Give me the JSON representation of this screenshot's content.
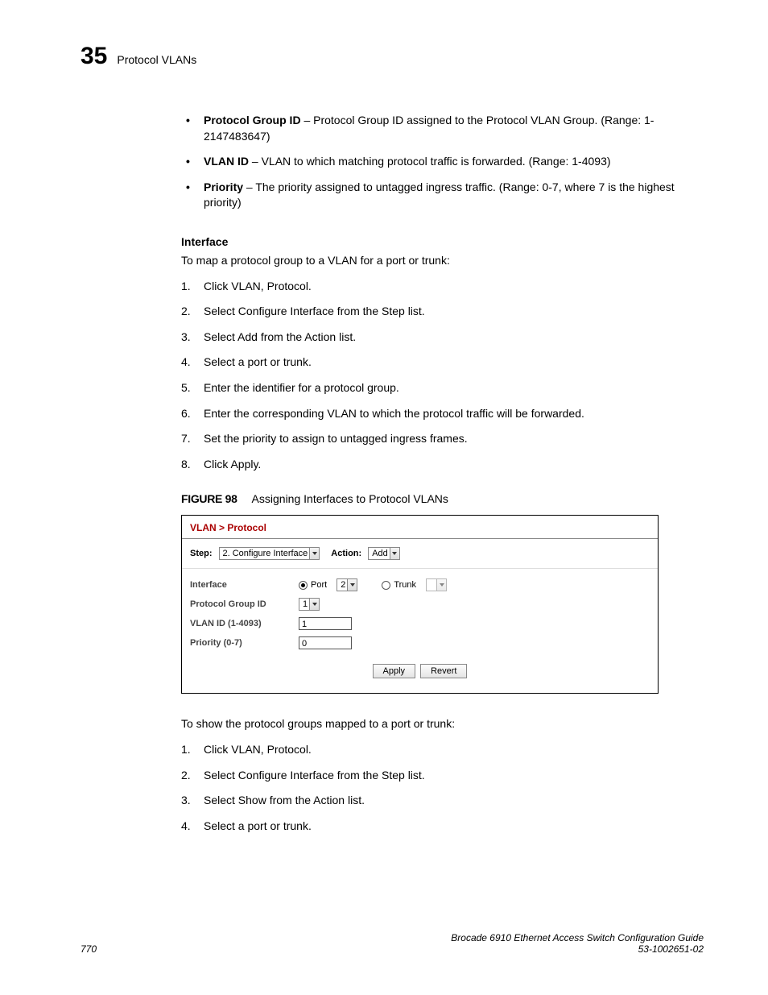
{
  "header": {
    "chapter_number": "35",
    "chapter_title": "Protocol VLANs"
  },
  "bullets": [
    {
      "term": "Protocol Group ID",
      "desc": " – Protocol Group ID assigned to the Protocol VLAN Group. (Range: 1-2147483647)"
    },
    {
      "term": "VLAN ID",
      "desc": " – VLAN to which matching protocol traffic is forwarded. (Range: 1-4093)"
    },
    {
      "term": "Priority",
      "desc": " – The priority assigned to untagged ingress traffic. (Range: 0-7, where 7 is the highest priority)"
    }
  ],
  "interface_heading": "Interface",
  "interface_intro": "To map a protocol group to a VLAN for a port or trunk:",
  "steps1": [
    "Click VLAN, Protocol.",
    "Select Configure Interface from the Step list.",
    "Select Add from the Action list.",
    "Select a port or trunk.",
    "Enter the identifier for a protocol group.",
    "Enter the corresponding VLAN to which the protocol traffic will be forwarded.",
    "Set the priority to assign to untagged ingress frames.",
    "Click Apply."
  ],
  "figure": {
    "label": "FIGURE 98",
    "title": "Assigning Interfaces to Protocol VLANs",
    "breadcrumb": "VLAN > Protocol",
    "toolbar": {
      "step_label": "Step:",
      "step_value": "2. Configure Interface",
      "action_label": "Action:",
      "action_value": "Add"
    },
    "rows": {
      "interface_label": "Interface",
      "port_label": "Port",
      "port_value": "2",
      "trunk_label": "Trunk",
      "trunk_value": "",
      "pgid_label": "Protocol Group ID",
      "pgid_value": "1",
      "vlan_label": "VLAN ID (1-4093)",
      "vlan_value": "1",
      "priority_label": "Priority (0-7)",
      "priority_value": "0"
    },
    "buttons": {
      "apply": "Apply",
      "revert": "Revert"
    }
  },
  "show_intro": "To show the protocol groups mapped to a port or trunk:",
  "steps2": [
    "Click VLAN, Protocol.",
    "Select Configure Interface from the Step list.",
    "Select Show from the Action list.",
    "Select a port or trunk."
  ],
  "footer": {
    "page_number": "770",
    "doc_title": "Brocade 6910 Ethernet Access Switch Configuration Guide",
    "doc_num": "53-1002651-02"
  }
}
